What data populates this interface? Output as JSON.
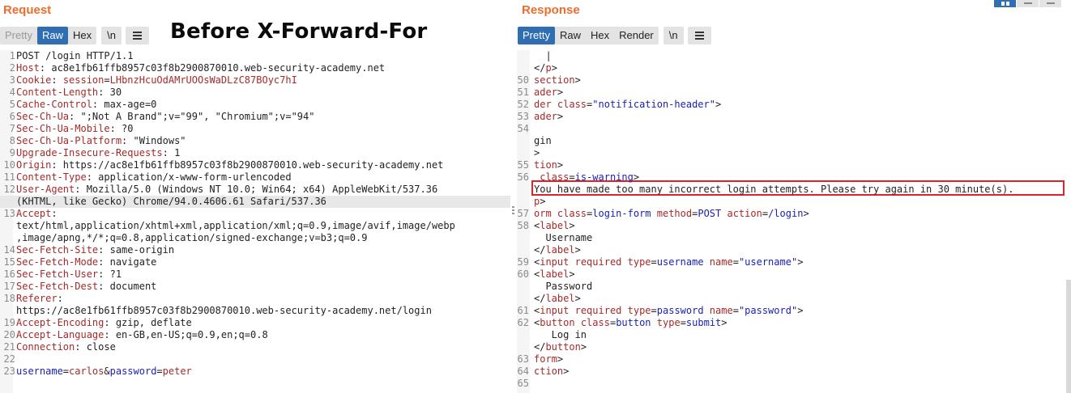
{
  "request": {
    "title": "Request",
    "tabs": [
      "Pretty",
      "Raw",
      "Hex"
    ],
    "newline_label": "\\n",
    "lines": [
      {
        "n": "1",
        "parts": [
          [
            "",
            "POST /login HTTP/1.1"
          ]
        ]
      },
      {
        "n": "2",
        "parts": [
          [
            "k",
            "Host"
          ],
          [
            "",
            ": ac8e1fb61ffb8957c03f8b2900870010.web-security-academy.net"
          ]
        ]
      },
      {
        "n": "3",
        "parts": [
          [
            "k",
            "Cookie"
          ],
          [
            "",
            ": "
          ],
          [
            "k",
            "session"
          ],
          [
            "",
            "="
          ],
          [
            "k",
            "LHbnzHcuOdAMrUOOsWaDLzC87BOyc7hI"
          ]
        ]
      },
      {
        "n": "4",
        "parts": [
          [
            "k",
            "Content-Length"
          ],
          [
            "",
            ": 30"
          ]
        ]
      },
      {
        "n": "5",
        "parts": [
          [
            "k",
            "Cache-Control"
          ],
          [
            "",
            ": max-age=0"
          ]
        ]
      },
      {
        "n": "6",
        "parts": [
          [
            "k",
            "Sec-Ch-Ua"
          ],
          [
            "",
            ": \";Not A Brand\";v=\"99\", \"Chromium\";v=\"94\""
          ]
        ]
      },
      {
        "n": "7",
        "parts": [
          [
            "k",
            "Sec-Ch-Ua-Mobile"
          ],
          [
            "",
            ": ?0"
          ]
        ]
      },
      {
        "n": "8",
        "parts": [
          [
            "k",
            "Sec-Ch-Ua-Platform"
          ],
          [
            "",
            ": \"Windows\""
          ]
        ]
      },
      {
        "n": "9",
        "parts": [
          [
            "k",
            "Upgrade-Insecure-Requests"
          ],
          [
            "",
            ": 1"
          ]
        ]
      },
      {
        "n": "10",
        "parts": [
          [
            "k",
            "Origin"
          ],
          [
            "",
            ": https://ac8e1fb61ffb8957c03f8b2900870010.web-security-academy.net"
          ]
        ]
      },
      {
        "n": "11",
        "parts": [
          [
            "k",
            "Content-Type"
          ],
          [
            "",
            ": application/x-www-form-urlencoded"
          ]
        ]
      },
      {
        "n": "12",
        "parts": [
          [
            "k",
            "User-Agent"
          ],
          [
            "",
            ": Mozilla/5.0 (Windows NT 10.0; Win64; x64) AppleWebKit/537.36"
          ]
        ]
      },
      {
        "n": "",
        "hl": true,
        "parts": [
          [
            "",
            "(KHTML, like Gecko) Chrome/94.0.4606.61 Safari/537.36"
          ]
        ]
      },
      {
        "n": "13",
        "parts": [
          [
            "k",
            "Accept"
          ],
          [
            "",
            ":"
          ]
        ]
      },
      {
        "n": "",
        "parts": [
          [
            "",
            "text/html,application/xhtml+xml,application/xml;q=0.9,image/avif,image/webp"
          ]
        ]
      },
      {
        "n": "",
        "parts": [
          [
            "",
            ",image/apng,*/*;q=0.8,application/signed-exchange;v=b3;q=0.9"
          ]
        ]
      },
      {
        "n": "14",
        "parts": [
          [
            "k",
            "Sec-Fetch-Site"
          ],
          [
            "",
            ": same-origin"
          ]
        ]
      },
      {
        "n": "15",
        "parts": [
          [
            "k",
            "Sec-Fetch-Mode"
          ],
          [
            "",
            ": navigate"
          ]
        ]
      },
      {
        "n": "16",
        "parts": [
          [
            "k",
            "Sec-Fetch-User"
          ],
          [
            "",
            ": ?1"
          ]
        ]
      },
      {
        "n": "17",
        "parts": [
          [
            "k",
            "Sec-Fetch-Dest"
          ],
          [
            "",
            ": document"
          ]
        ]
      },
      {
        "n": "18",
        "parts": [
          [
            "k",
            "Referer"
          ],
          [
            "",
            ":"
          ]
        ]
      },
      {
        "n": "",
        "parts": [
          [
            "",
            "https://ac8e1fb61ffb8957c03f8b2900870010.web-security-academy.net/login"
          ]
        ]
      },
      {
        "n": "19",
        "parts": [
          [
            "k",
            "Accept-Encoding"
          ],
          [
            "",
            ": gzip, deflate"
          ]
        ]
      },
      {
        "n": "20",
        "parts": [
          [
            "k",
            "Accept-Language"
          ],
          [
            "",
            ": en-GB,en-US;q=0.9,en;q=0.8"
          ]
        ]
      },
      {
        "n": "21",
        "parts": [
          [
            "k",
            "Connection"
          ],
          [
            "",
            ": close"
          ]
        ]
      },
      {
        "n": "22",
        "parts": [
          [
            "",
            ""
          ]
        ]
      },
      {
        "n": "23",
        "parts": [
          [
            "b",
            "username"
          ],
          [
            "",
            "="
          ],
          [
            "k",
            "carlos"
          ],
          [
            "",
            "&"
          ],
          [
            "b",
            "password"
          ],
          [
            "",
            "="
          ],
          [
            "k",
            "peter"
          ]
        ]
      }
    ]
  },
  "overlay_caption": "Before X-Forward-For",
  "response": {
    "title": "Response",
    "tabs": [
      "Pretty",
      "Raw",
      "Hex",
      "Render"
    ],
    "newline_label": "\\n",
    "lines": [
      {
        "n": "",
        "parts": [
          [
            "",
            "  |"
          ]
        ]
      },
      {
        "n": "",
        "parts": [
          [
            "",
            "</"
          ],
          [
            "t",
            "p"
          ],
          [
            "",
            ">"
          ]
        ]
      },
      {
        "n": "50",
        "parts": [
          [
            "t",
            "section"
          ],
          [
            "",
            ">"
          ]
        ]
      },
      {
        "n": "51",
        "parts": [
          [
            "t",
            "ader"
          ],
          [
            "",
            ">"
          ]
        ]
      },
      {
        "n": "52",
        "parts": [
          [
            "t",
            "der "
          ],
          [
            "a",
            "class"
          ],
          [
            "",
            "="
          ],
          [
            "s",
            "\"notification-header\""
          ],
          [
            "",
            ">"
          ]
        ]
      },
      {
        "n": "53",
        "parts": [
          [
            "t",
            "ader"
          ],
          [
            "",
            ">"
          ]
        ]
      },
      {
        "n": "54",
        "parts": [
          [
            "",
            ""
          ]
        ]
      },
      {
        "n": "",
        "parts": [
          [
            "",
            "gin"
          ]
        ]
      },
      {
        "n": "",
        "parts": [
          [
            "",
            ">"
          ]
        ]
      },
      {
        "n": "55",
        "parts": [
          [
            "t",
            "tion"
          ],
          [
            "",
            ">"
          ]
        ]
      },
      {
        "n": "56",
        "parts": [
          [
            "",
            " "
          ],
          [
            "a",
            "class"
          ],
          [
            "",
            "="
          ],
          [
            "s",
            "is-warning"
          ],
          [
            "",
            ">"
          ]
        ]
      },
      {
        "n": "",
        "parts": [
          [
            "",
            "You have made too many incorrect login attempts. Please try again in 30 minute(s)."
          ]
        ]
      },
      {
        "n": "",
        "parts": [
          [
            "t",
            "p"
          ],
          [
            "",
            ">"
          ]
        ]
      },
      {
        "n": "57",
        "parts": [
          [
            "t",
            "orm "
          ],
          [
            "a",
            "class"
          ],
          [
            "",
            "="
          ],
          [
            "s",
            "login-form"
          ],
          [
            "",
            " "
          ],
          [
            "a",
            "method"
          ],
          [
            "",
            "="
          ],
          [
            "s",
            "POST"
          ],
          [
            "",
            " "
          ],
          [
            "a",
            "action"
          ],
          [
            "",
            "="
          ],
          [
            "s",
            "/login"
          ],
          [
            "",
            ">"
          ]
        ]
      },
      {
        "n": "58",
        "parts": [
          [
            "",
            "<"
          ],
          [
            "t",
            "label"
          ],
          [
            "",
            ">"
          ]
        ]
      },
      {
        "n": "",
        "parts": [
          [
            "",
            "  Username"
          ]
        ]
      },
      {
        "n": "",
        "parts": [
          [
            "",
            "</"
          ],
          [
            "t",
            "label"
          ],
          [
            "",
            ">"
          ]
        ]
      },
      {
        "n": "59",
        "parts": [
          [
            "",
            "<"
          ],
          [
            "t",
            "input"
          ],
          [
            "",
            " "
          ],
          [
            "a",
            "required"
          ],
          [
            "",
            " "
          ],
          [
            "a",
            "type"
          ],
          [
            "",
            "="
          ],
          [
            "s",
            "username"
          ],
          [
            "",
            " "
          ],
          [
            "a",
            "name"
          ],
          [
            "",
            "="
          ],
          [
            "s",
            "\"username\""
          ],
          [
            "",
            ">"
          ]
        ]
      },
      {
        "n": "60",
        "parts": [
          [
            "",
            "<"
          ],
          [
            "t",
            "label"
          ],
          [
            "",
            ">"
          ]
        ]
      },
      {
        "n": "",
        "parts": [
          [
            "",
            "  Password"
          ]
        ]
      },
      {
        "n": "",
        "parts": [
          [
            "",
            "</"
          ],
          [
            "t",
            "label"
          ],
          [
            "",
            ">"
          ]
        ]
      },
      {
        "n": "61",
        "parts": [
          [
            "",
            "<"
          ],
          [
            "t",
            "input"
          ],
          [
            "",
            " "
          ],
          [
            "a",
            "required"
          ],
          [
            "",
            " "
          ],
          [
            "a",
            "type"
          ],
          [
            "",
            "="
          ],
          [
            "s",
            "password"
          ],
          [
            "",
            " "
          ],
          [
            "a",
            "name"
          ],
          [
            "",
            "="
          ],
          [
            "s",
            "\"password\""
          ],
          [
            "",
            ">"
          ]
        ]
      },
      {
        "n": "62",
        "parts": [
          [
            "",
            "<"
          ],
          [
            "t",
            "button"
          ],
          [
            "",
            " "
          ],
          [
            "a",
            "class"
          ],
          [
            "",
            "="
          ],
          [
            "s",
            "button"
          ],
          [
            "",
            " "
          ],
          [
            "a",
            "type"
          ],
          [
            "",
            "="
          ],
          [
            "s",
            "submit"
          ],
          [
            "",
            ">"
          ]
        ]
      },
      {
        "n": "",
        "parts": [
          [
            "",
            "   Log in"
          ]
        ]
      },
      {
        "n": "",
        "parts": [
          [
            "",
            "</"
          ],
          [
            "t",
            "button"
          ],
          [
            "",
            ">"
          ]
        ]
      },
      {
        "n": "63",
        "parts": [
          [
            "t",
            "form"
          ],
          [
            "",
            ">"
          ]
        ]
      },
      {
        "n": "64",
        "parts": [
          [
            "t",
            "ction"
          ],
          [
            "",
            ">"
          ]
        ]
      },
      {
        "n": "65",
        "parts": [
          [
            "",
            ""
          ]
        ]
      }
    ]
  },
  "colors": {
    "title_orange": "#ef6c2a",
    "active_tab_blue": "#2f6eb2",
    "highlight_red": "#d9242a"
  }
}
